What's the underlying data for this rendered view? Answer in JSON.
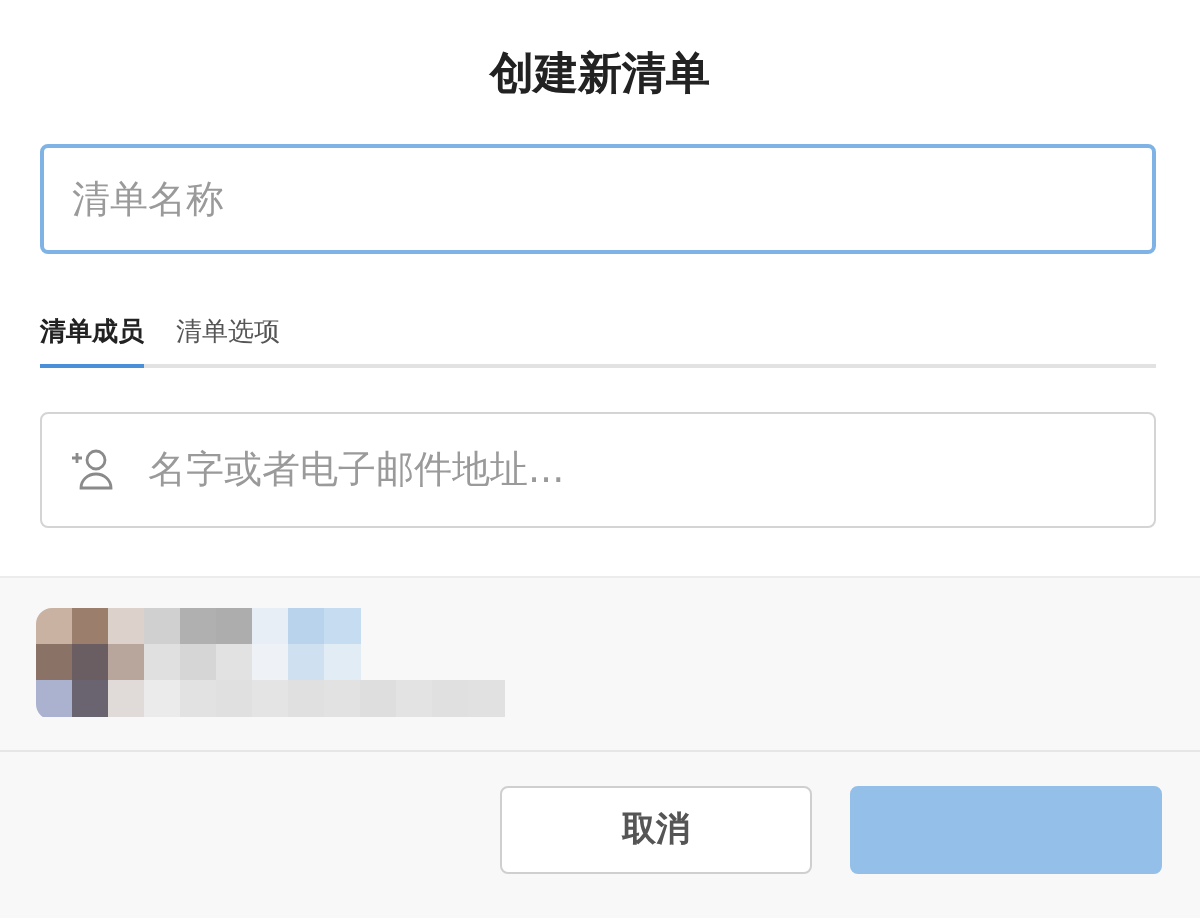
{
  "dialog": {
    "title": "创建新清单"
  },
  "name_field": {
    "placeholder": "清单名称",
    "focused": true
  },
  "tabs": [
    {
      "label": "清单成员",
      "selected": true
    },
    {
      "label": "清单选项",
      "selected": false
    }
  ],
  "member_field": {
    "placeholder": "名字或者电子邮件地址..."
  },
  "buttons": [
    {
      "label": "取消",
      "kind": "secondary",
      "disabled": false
    },
    {
      "kind": "primary",
      "disabled": true
    }
  ]
}
